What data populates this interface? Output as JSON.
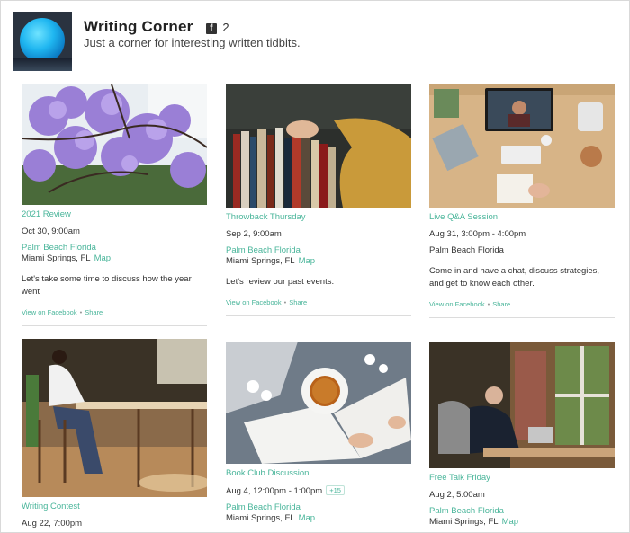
{
  "header": {
    "title": "Writing Corner",
    "fb_count": "2",
    "tagline": "Just a corner for interesting written tidbits."
  },
  "events": [
    {
      "title": "2021 Review",
      "date": "Oct 30, 9:00am",
      "place": "Palm Beach Florida",
      "city": "Miami Springs, FL",
      "map": "Map",
      "desc": "Let's take some time to discuss how the year went",
      "view": "View on Facebook",
      "share": "Share"
    },
    {
      "title": "Throwback Thursday",
      "date": "Sep 2, 9:00am",
      "place": "Palm Beach Florida",
      "city": "Miami Springs, FL",
      "map": "Map",
      "desc": "Let's review our past events.",
      "view": "View on Facebook",
      "share": "Share"
    },
    {
      "title": "Live Q&A Session",
      "date": "Aug 31, 3:00pm - 4:00pm",
      "place": "Palm Beach Florida",
      "desc": "Come in and have a chat, discuss strategies, and get to know each other.",
      "view": "View on Facebook",
      "share": "Share"
    },
    {
      "title": "Writing Contest",
      "date": "Aug 22, 7:00pm"
    },
    {
      "title": "Book Club Discussion",
      "date": "Aug 4, 12:00pm - 1:00pm",
      "more": "+15",
      "place": "Palm Beach Florida",
      "city": "Miami Springs, FL",
      "map": "Map"
    },
    {
      "title": "Free Talk Friday",
      "date": "Aug 2, 5:00am",
      "place": "Palm Beach Florida",
      "city": "Miami Springs, FL",
      "map": "Map"
    }
  ],
  "colors": {
    "accent": "#49b59a",
    "border": "#d9d9d9",
    "text": "#333333"
  }
}
